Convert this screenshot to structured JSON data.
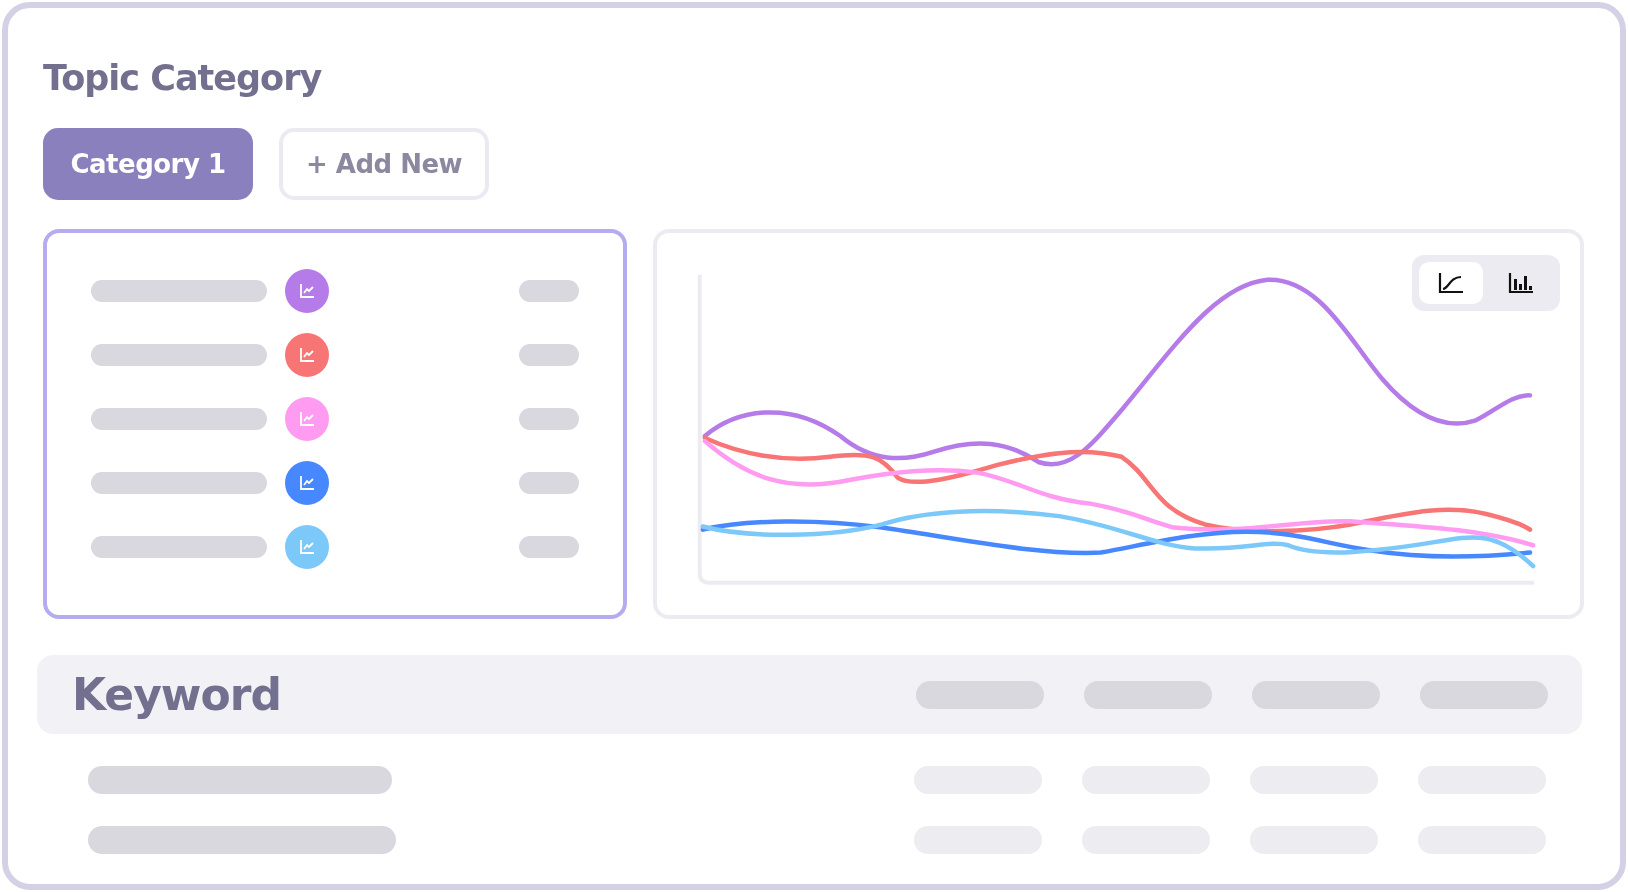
{
  "title": "Topic Category",
  "tabs": [
    {
      "label": "Category 1",
      "selected": true
    },
    {
      "label": "+ Add New",
      "selected": false
    }
  ],
  "series": [
    {
      "color": "#b57be8"
    },
    {
      "color": "#f87575"
    },
    {
      "color": "#ff9bf0"
    },
    {
      "color": "#4787ff"
    },
    {
      "color": "#7cc8f8"
    }
  ],
  "chart_views": [
    {
      "kind": "line",
      "selected": true
    },
    {
      "kind": "bar",
      "selected": false
    }
  ],
  "keyword_table": {
    "header": "Keyword"
  }
}
